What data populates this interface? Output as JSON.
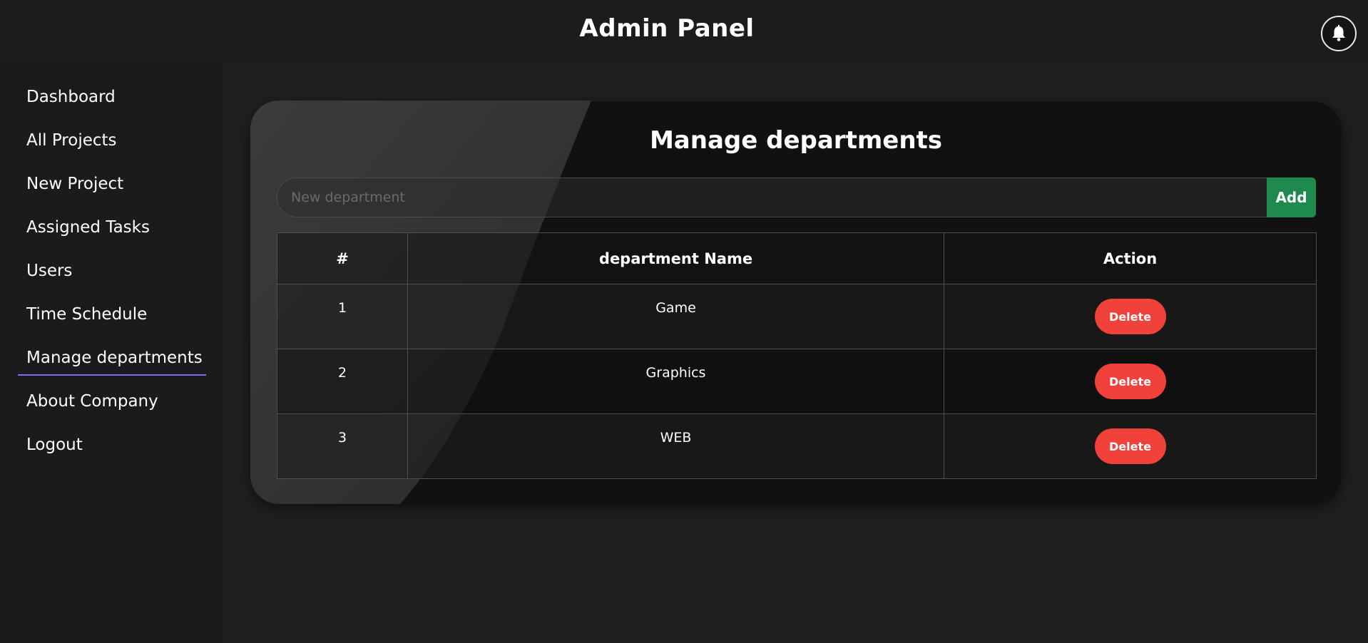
{
  "header": {
    "title": "Admin Panel",
    "notification_icon": "bell-icon"
  },
  "sidebar": {
    "items": [
      {
        "label": "Dashboard"
      },
      {
        "label": "All Projects"
      },
      {
        "label": "New Project"
      },
      {
        "label": "Assigned Tasks"
      },
      {
        "label": "Users"
      },
      {
        "label": "Time Schedule"
      },
      {
        "label": "Manage departments",
        "active": true
      },
      {
        "label": "About Company"
      },
      {
        "label": "Logout"
      }
    ],
    "active_underline_color": "#7b6cff"
  },
  "main": {
    "title": "Manage departments",
    "input": {
      "placeholder": "New department",
      "value": ""
    },
    "add_label": "Add",
    "table": {
      "headers": [
        "#",
        "department Name",
        "Action"
      ],
      "rows": [
        {
          "num": "1",
          "name": "Game",
          "action": "Delete"
        },
        {
          "num": "2",
          "name": "Graphics",
          "action": "Delete"
        },
        {
          "num": "3",
          "name": "WEB",
          "action": "Delete"
        }
      ]
    }
  },
  "colors": {
    "add_button": "#1e8a4e",
    "delete_button": "#f0413a",
    "background": "#202020"
  }
}
